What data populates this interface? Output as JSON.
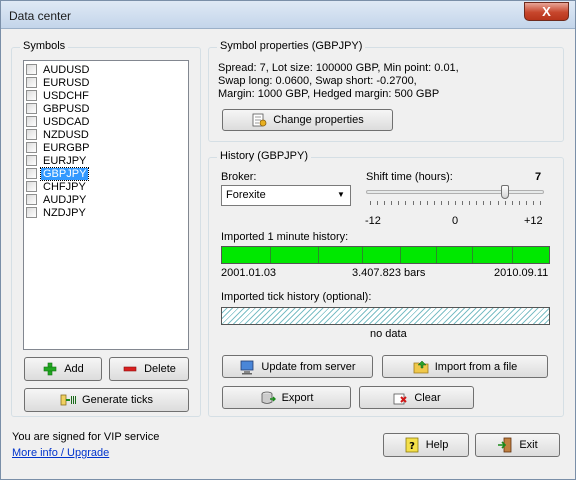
{
  "window": {
    "title": "Data center",
    "close_label": "X"
  },
  "symbols": {
    "group_label": "Symbols",
    "items": [
      "AUDUSD",
      "EURUSD",
      "USDCHF",
      "GBPUSD",
      "USDCAD",
      "NZDUSD",
      "EURGBP",
      "EURJPY",
      "GBPJPY",
      "CHFJPY",
      "AUDJPY",
      "NZDJPY"
    ],
    "selected": "GBPJPY",
    "add_label": "Add",
    "delete_label": "Delete",
    "generate_ticks_label": "Generate ticks"
  },
  "properties": {
    "group_label": "Symbol properties (GBPJPY)",
    "line1": "Spread: 7, Lot size: 100000 GBP, Min point: 0.01,",
    "line2": "Swap long: 0.0600, Swap short: -0.2700,",
    "line3": "Margin: 1000 GBP, Hedged margin: 500 GBP",
    "change_label": "Change properties"
  },
  "history": {
    "group_label": "History (GBPJPY)",
    "broker_label": "Broker:",
    "broker_value": "Forexite",
    "shift_label": "Shift time (hours):",
    "shift_value": "7",
    "shift_min": -12,
    "shift_max": 12,
    "shift_min_label": "-12",
    "shift_mid_label": "0",
    "shift_max_label": "+12",
    "minute_label": "Imported 1 minute history:",
    "minute_start": "2001.01.03",
    "minute_count": "3.407.823 bars",
    "minute_end": "2010.09.11",
    "tick_label": "Imported tick history (optional):",
    "tick_status": "no data",
    "update_label": "Update from server",
    "import_label": "Import from a file",
    "export_label": "Export",
    "clear_label": "Clear"
  },
  "footer": {
    "vip_text": "You are signed for VIP service",
    "more_info_link": "More info / Upgrade",
    "help_label": "Help",
    "exit_label": "Exit"
  },
  "colors": {
    "selection": "#3399ff",
    "history_bar": "#00e800",
    "link": "#0033cc"
  },
  "icons": {
    "add": "plus-icon",
    "delete": "minus-icon",
    "generate": "generate-ticks-icon",
    "change": "properties-icon",
    "update": "computer-icon",
    "import": "folder-icon",
    "export": "database-icon",
    "clear": "eraser-icon",
    "help": "help-icon",
    "exit": "exit-door-icon"
  }
}
